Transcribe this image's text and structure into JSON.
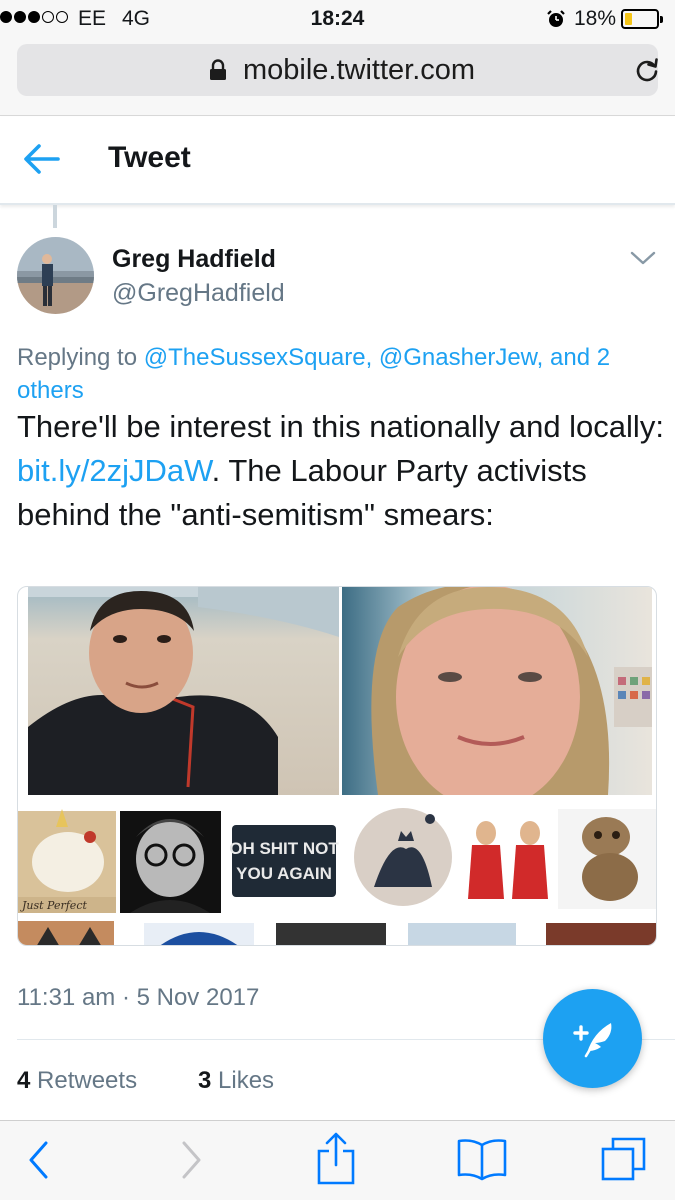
{
  "status_bar": {
    "carrier": "EE",
    "network": "4G",
    "time": "18:24",
    "battery_percent": "18%",
    "battery_level": 0.18,
    "signal_bars": 3,
    "icons": [
      "alarm-icon",
      "battery-icon"
    ]
  },
  "browser": {
    "url": "mobile.twitter.com",
    "icons": [
      "lock-icon",
      "reload-icon",
      "back-icon",
      "forward-icon",
      "share-icon",
      "bookmarks-icon",
      "tabs-icon"
    ]
  },
  "header": {
    "title": "Tweet",
    "back_icon": "back-arrow-icon"
  },
  "tweet": {
    "author_name": "Greg Hadfield",
    "author_handle": "@GregHadfield",
    "replying_prefix": "Replying to ",
    "replying_mentions": "@TheSussexSquare, @GnasherJew, and 2 others",
    "text_before_link": "There'll be interest in this nationally and locally: ",
    "link": "bit.ly/2zjJDaW",
    "text_after_link": ". The Labour Party activists behind the \"anti-semitism\" smears:",
    "media_caption_text": "OH SHIT NOT YOU AGAIN",
    "media_stamp_text": "Just Perfect",
    "timestamp": "11:31 am · 5 Nov 2017",
    "retweets_count": "4",
    "retweets_label": " Retweets",
    "likes_count": "3",
    "likes_label": " Likes"
  },
  "colors": {
    "accent": "#1da1f2",
    "text_primary": "#14171a",
    "text_secondary": "#657786",
    "safari_blue": "#007aff"
  }
}
